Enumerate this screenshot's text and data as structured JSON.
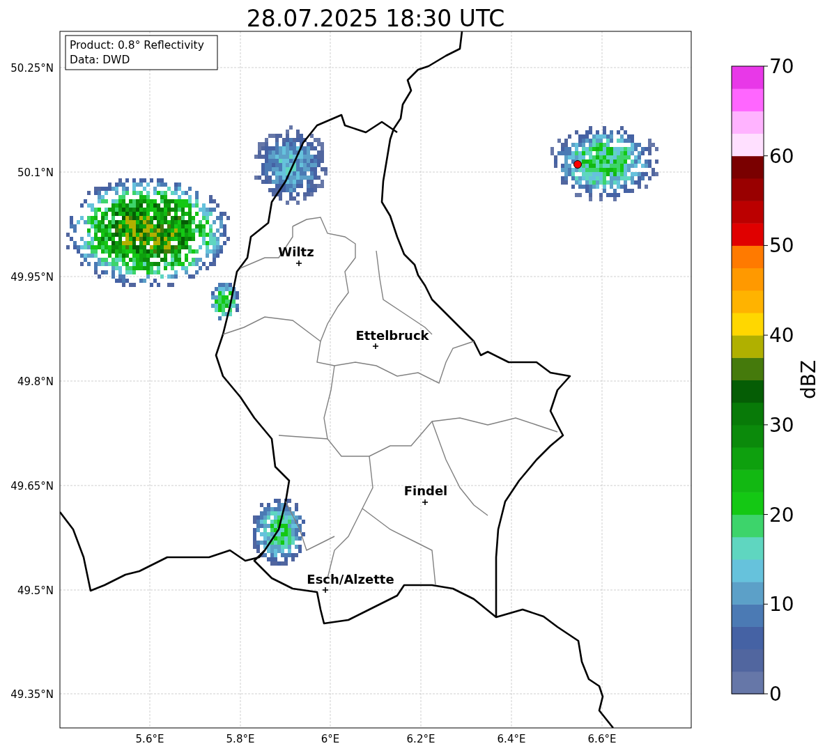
{
  "title": "28.07.2025 18:30 UTC",
  "info_box": [
    "Product: 0.8° Reflectivity",
    "Data: DWD"
  ],
  "lat_labels": [
    "50.25°N",
    "50.1°N",
    "49.95°N",
    "49.8°N",
    "49.65°N",
    "49.5°N",
    "49.35°N"
  ],
  "lon_labels": [
    "5.6°E",
    "5.8°E",
    "6°E",
    "6.2°E",
    "6.4°E",
    "6.6°E"
  ],
  "places": [
    {
      "name": "Wiltz"
    },
    {
      "name": "Ettelbruck"
    },
    {
      "name": "Findel"
    },
    {
      "name": "Esch/Alzette"
    }
  ],
  "colorbar": {
    "label": "dBZ",
    "ticks": [
      "70",
      "60",
      "50",
      "40",
      "30",
      "20",
      "10",
      "0"
    ],
    "segments": [
      {
        "color": "#6677a8"
      },
      {
        "color": "#51669f"
      },
      {
        "color": "#4562a4"
      },
      {
        "color": "#4b7ab4"
      },
      {
        "color": "#5ca0c8"
      },
      {
        "color": "#66c2dc"
      },
      {
        "color": "#5fd6c0"
      },
      {
        "color": "#3dd46b"
      },
      {
        "color": "#14c814"
      },
      {
        "color": "#12b812"
      },
      {
        "color": "#0ea00e"
      },
      {
        "color": "#0b8a0b"
      },
      {
        "color": "#087a08"
      },
      {
        "color": "#055d05"
      },
      {
        "color": "#457a0c"
      },
      {
        "color": "#b0b000"
      },
      {
        "color": "#ffd700"
      },
      {
        "color": "#ffb300"
      },
      {
        "color": "#ff9900"
      },
      {
        "color": "#ff7a00"
      },
      {
        "color": "#e00000"
      },
      {
        "color": "#bb0000"
      },
      {
        "color": "#990000"
      },
      {
        "color": "#7a0000"
      },
      {
        "color": "#ffe0ff"
      },
      {
        "color": "#ffb3ff"
      },
      {
        "color": "#ff66ff"
      },
      {
        "color": "#e838e8"
      }
    ]
  }
}
